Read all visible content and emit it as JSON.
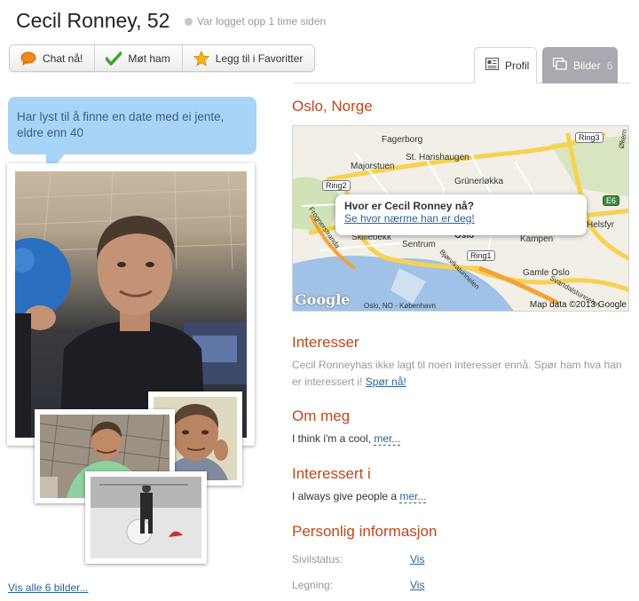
{
  "header": {
    "name_age": "Cecil Ronney, 52",
    "status": "Var logget opp 1 time siden"
  },
  "actions": {
    "chat": "Chat nå!",
    "meet": "Møt ham",
    "favorite": "Legg til i Favoritter"
  },
  "tabs": {
    "profil": "Profil",
    "bilder": "Bilder",
    "bilder_count": "6"
  },
  "bubble": {
    "text": "Har lyst til å finne en date med ei jente, eldre enn 40"
  },
  "photos": {
    "see_all": "Vis alle 6 bilder..."
  },
  "location": {
    "heading": "Oslo, Norge",
    "map": {
      "popup_title": "Hvor er Cecil Ronney nå?",
      "popup_link": "Se hvor nærme han er deg!",
      "google": "Google",
      "copyright": "Map data ©2013 Google",
      "labels": [
        "Fagerborg",
        "St. Hanshaugen",
        "Majorstuen",
        "Grünerløkka",
        "Skillebekk",
        "Sentrum",
        "Oslo",
        "Kampen",
        "Helsfyr",
        "Gamle Oslo",
        "Bjørvikatunnelen",
        "Frognerstranda",
        "Ring3",
        "Ring2",
        "Ring1",
        "E6",
        "Økern",
        "Oslo, NO - København",
        "Svartdalstunnelen"
      ]
    }
  },
  "interests": {
    "heading": "Interesser",
    "text": "Cecil Ronneyhas ikke lagt til noen interesser ennå. Spør ham hva han er interessert i!",
    "link": "Spør nå!"
  },
  "about": {
    "heading": "Om meg",
    "text": "I think i'm a cool,",
    "more": "mer..."
  },
  "interested_in": {
    "heading": "Interessert i",
    "text": "I always give people a",
    "more": "mer..."
  },
  "personal": {
    "heading": "Personlig informasjon",
    "rows": [
      {
        "label": "Sivilstatus:",
        "value": "Vis"
      },
      {
        "label": "Legning:",
        "value": "Vis"
      }
    ]
  }
}
